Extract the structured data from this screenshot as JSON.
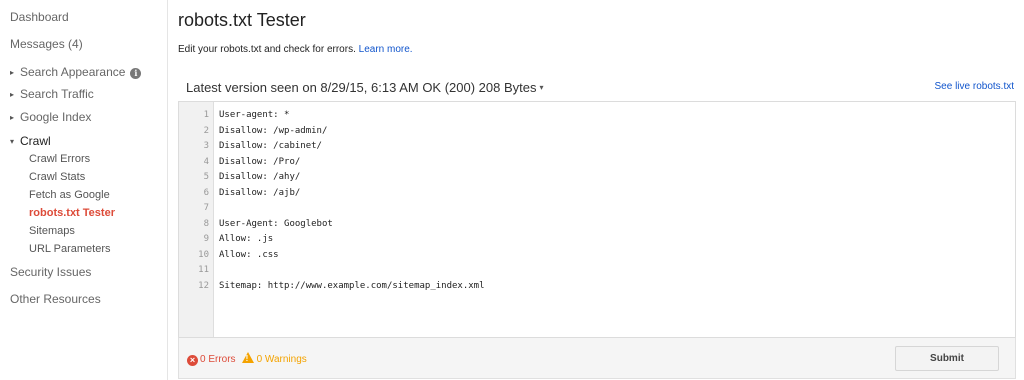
{
  "sidebar": {
    "dashboard": "Dashboard",
    "messages": "Messages (4)",
    "search_appearance": "Search Appearance",
    "search_traffic": "Search Traffic",
    "google_index": "Google Index",
    "crawl": "Crawl",
    "crawl_items": [
      "Crawl Errors",
      "Crawl Stats",
      "Fetch as Google",
      "robots.txt Tester",
      "Sitemaps",
      "URL Parameters"
    ],
    "security_issues": "Security Issues",
    "other_resources": "Other Resources",
    "info_glyph": "i",
    "expand_glyph": "▸",
    "collapse_glyph": "▾"
  },
  "main": {
    "title": "robots.txt Tester",
    "intro": "Edit your robots.txt and check for errors.",
    "learn_more": "Learn more.",
    "version_text": "Latest version seen on 8/29/15, 6:13 AM OK (200) 208 Bytes",
    "version_caret": "▾",
    "see_live": "See live robots.txt"
  },
  "editor": {
    "lines": [
      "User-agent: *",
      "Disallow: /wp-admin/",
      "Disallow: /cabinet/",
      "Disallow: /Pro/",
      "Disallow: /ahy/",
      "Disallow: /ajb/",
      "",
      "User-Agent: Googlebot",
      "Allow: .js",
      "Allow: .css",
      "",
      "Sitemap: http://www.example.com/sitemap_index.xml"
    ]
  },
  "footer": {
    "errors": "0 Errors",
    "warnings": "0 Warnings",
    "error_glyph": "×",
    "warning_glyph": "!",
    "submit": "Submit"
  },
  "colors": {
    "active_nav": "#dd4b39",
    "link": "#1155cc",
    "error": "#dd4b39",
    "warning": "#f4a300"
  }
}
